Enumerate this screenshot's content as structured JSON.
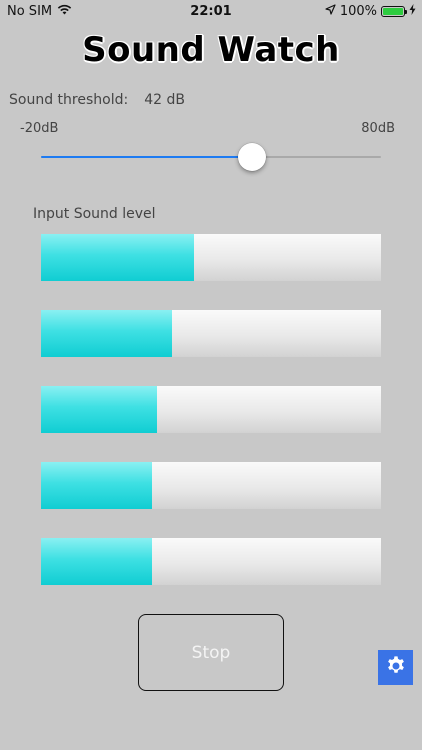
{
  "status_bar": {
    "carrier": "No SIM",
    "time": "22:01",
    "battery_percent": "100%",
    "battery_level": 1.0
  },
  "app": {
    "title": "Sound Watch"
  },
  "threshold": {
    "label": "Sound threshold:",
    "value_text": "42 dB",
    "min_label": "-20dB",
    "max_label": "80dB",
    "min": -20,
    "max": 80,
    "value": 42
  },
  "input_level": {
    "label": "Input Sound level",
    "levels": [
      0.45,
      0.385,
      0.34,
      0.325,
      0.325
    ]
  },
  "controls": {
    "stop_label": "Stop"
  },
  "colors": {
    "accent": "#1e7bf2",
    "meter_fill": "#2fd8dc",
    "settings_bg": "#3a73e6",
    "background": "#c8c8c8"
  },
  "icons": [
    "wifi-icon",
    "location-arrow-icon",
    "battery-icon",
    "charging-bolt-icon",
    "gear-icon"
  ]
}
